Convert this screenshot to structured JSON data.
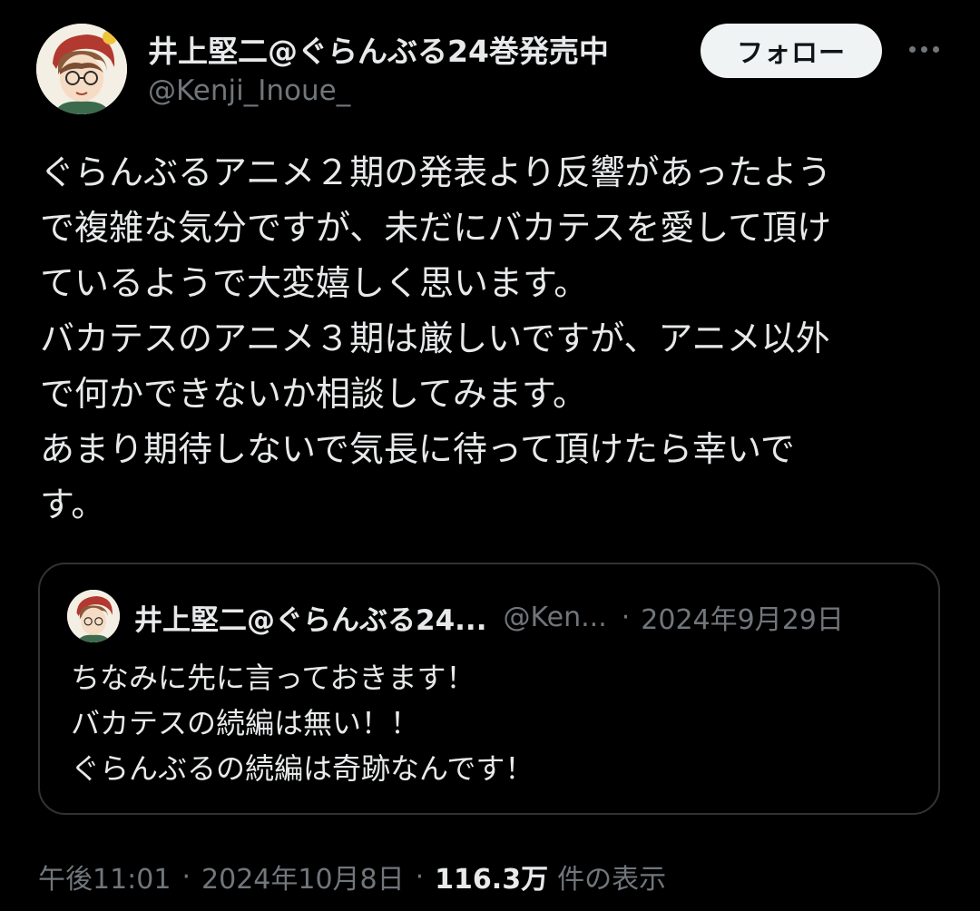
{
  "author": {
    "display_name": "井上堅二@ぐらんぶる24巻発売中",
    "handle": "@Kenji_Inoue_"
  },
  "actions": {
    "follow_label": "フォロー",
    "more_icon": "more-horizontal-icon"
  },
  "tweet": {
    "lines": [
      "ぐらんぶるアニメ２期の発表より反響があったよう",
      "で複雑な気分ですが、未だにバカテスを愛して頂け",
      "ているようで大変嬉しく思います。",
      "バカテスのアニメ３期は厳しいですが、アニメ以外",
      "で何かできないか相談してみます。",
      "あまり期待しないで気長に待って頂けたら幸いで",
      "す。"
    ]
  },
  "quoted": {
    "display_name": "井上堅二@ぐらんぶる24...",
    "handle": "@Ken...",
    "separator": "·",
    "date": "2024年9月29日",
    "lines": [
      "ちなみに先に言っておきます！",
      "バカテスの続編は無い！！",
      "ぐらんぶるの続編は奇跡なんです！"
    ]
  },
  "meta": {
    "time": "午後11:01",
    "separator": "·",
    "date": "2024年10月8日",
    "views_count": "116.3万",
    "views_label": "件の表示"
  },
  "colors": {
    "background": "#000000",
    "text_primary": "#e7e9ea",
    "text_secondary": "#71767b",
    "border": "#2f3336",
    "follow_button_bg": "#eff3f4"
  }
}
